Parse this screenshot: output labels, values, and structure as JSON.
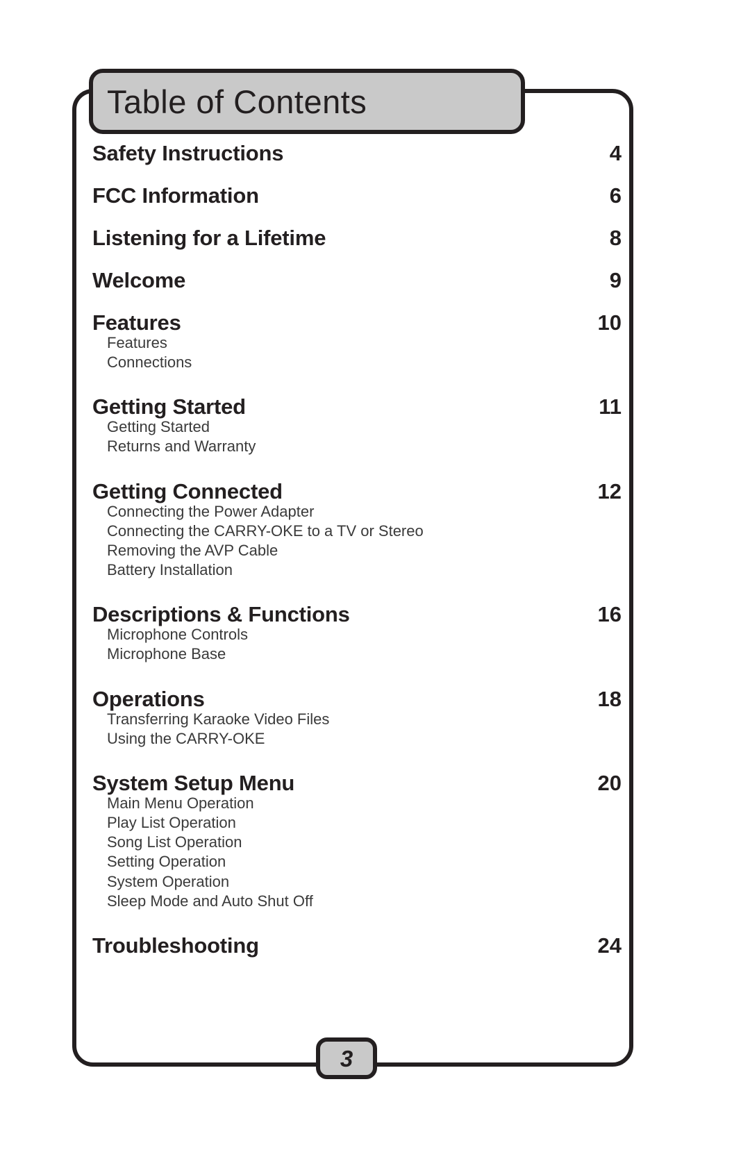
{
  "document": {
    "title": "Table of Contents",
    "page_number": "3"
  },
  "toc": {
    "entries": [
      {
        "title": "Safety Instructions",
        "page": "4",
        "sub_items": []
      },
      {
        "title": "FCC Information",
        "page": "6",
        "sub_items": []
      },
      {
        "title": "Listening for a Lifetime",
        "page": "8",
        "sub_items": []
      },
      {
        "title": "Welcome",
        "page": "9",
        "sub_items": []
      },
      {
        "title": "Features",
        "page": "10",
        "sub_items": [
          "Features",
          "Connections"
        ]
      },
      {
        "title": "Getting Started",
        "page": "11",
        "sub_items": [
          "Getting Started",
          "Returns and Warranty"
        ]
      },
      {
        "title": "Getting Connected",
        "page": "12",
        "sub_items": [
          "Connecting the Power Adapter",
          "Connecting the CARRY-OKE to a TV or Stereo",
          "Removing the AVP Cable",
          "Battery Installation"
        ]
      },
      {
        "title": "Descriptions & Functions",
        "page": "16",
        "sub_items": [
          "Microphone Controls",
          "Microphone Base"
        ]
      },
      {
        "title": "Operations",
        "page": "18",
        "sub_items": [
          "Transferring Karaoke Video Files",
          "Using the CARRY-OKE"
        ]
      },
      {
        "title": "System Setup Menu",
        "page": "20",
        "sub_items": [
          "Main Menu Operation",
          "Play List Operation",
          "Song List Operation",
          "Setting Operation",
          "System Operation",
          "Sleep Mode and Auto Shut Off"
        ]
      },
      {
        "title": "Troubleshooting",
        "page": "24",
        "sub_items": []
      }
    ]
  },
  "colors": {
    "ink": "#231f20",
    "panel_fill": "#c9c9c9",
    "sub_text": "#3a3a3a"
  }
}
